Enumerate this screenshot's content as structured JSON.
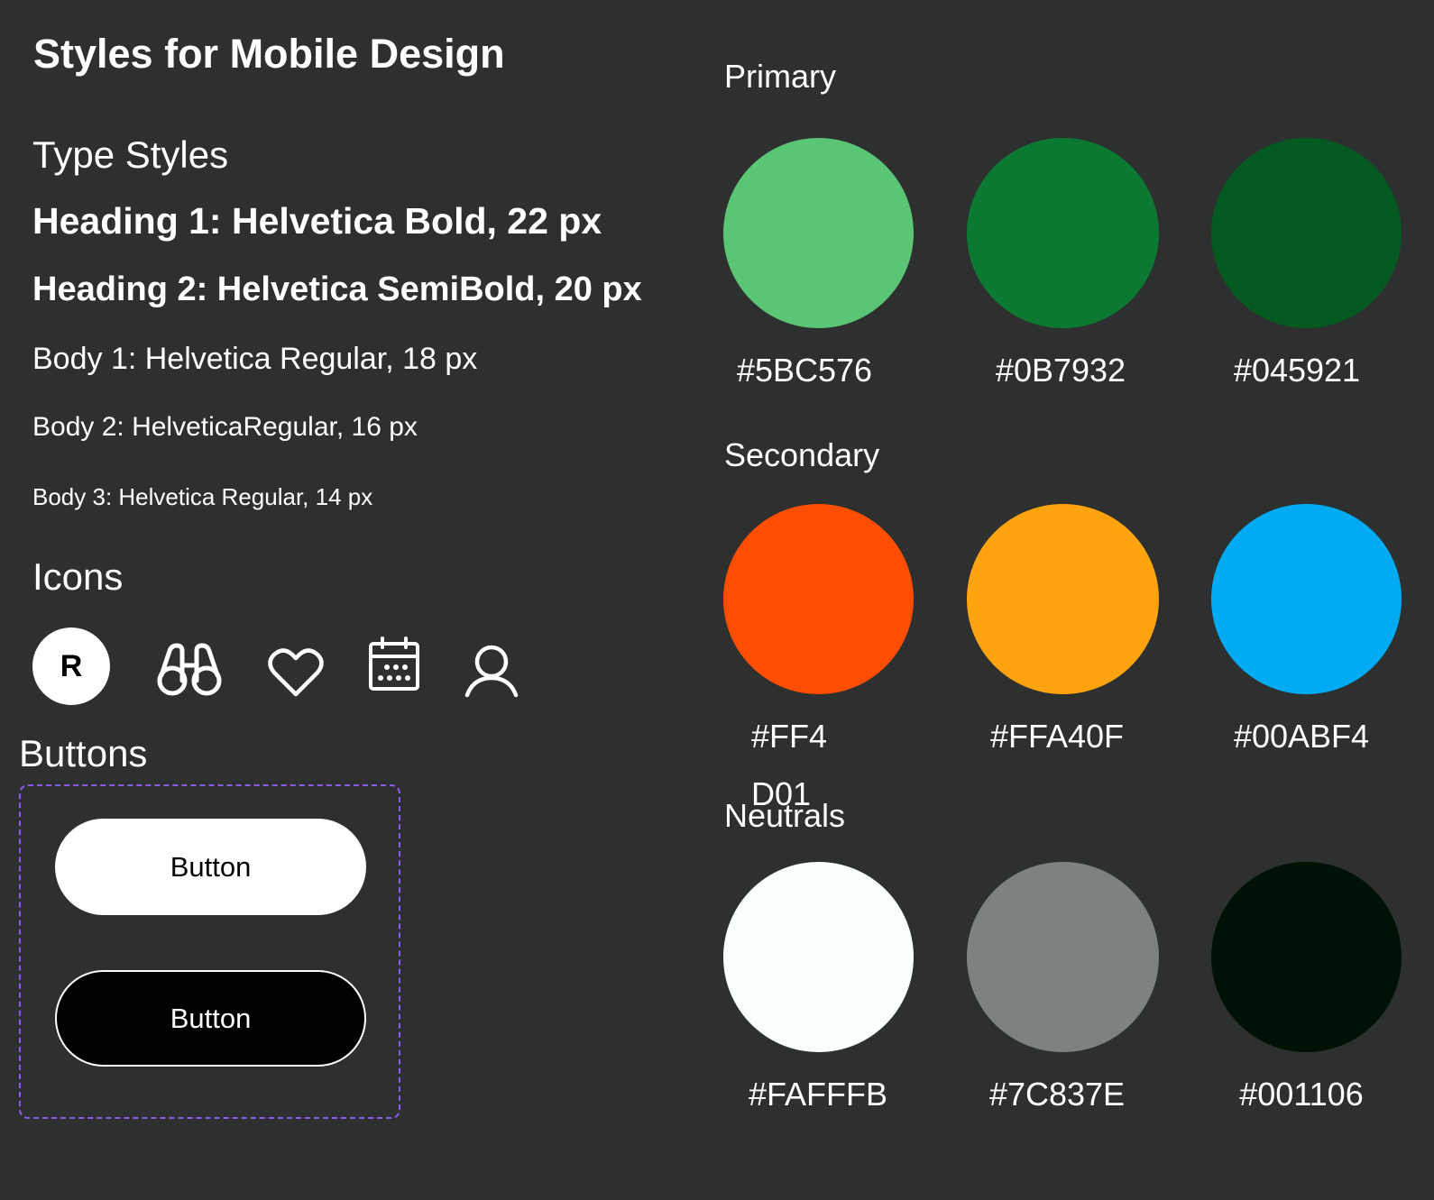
{
  "title": "Styles for Mobile Design",
  "type_styles": {
    "heading": "Type Styles",
    "h1": "Heading 1: Helvetica Bold, 22 px",
    "h2": "Heading 2: Helvetica SemiBold, 20 px",
    "body1": "Body 1: Helvetica Regular, 18 px",
    "body2": "Body 2: HelveticaRegular, 16 px",
    "body3": "Body 3: Helvetica Regular, 14 px"
  },
  "icons": {
    "heading": "Icons",
    "avatar_letter": "R",
    "list": [
      "avatar-icon",
      "binoculars-icon",
      "heart-icon",
      "calendar-icon",
      "user-icon"
    ]
  },
  "buttons": {
    "heading": "Buttons",
    "light_label": "Button",
    "dark_label": "Button"
  },
  "palette": {
    "primary": {
      "label": "Primary",
      "swatches": [
        {
          "color": "#5BC576",
          "label": "#5BC576"
        },
        {
          "color": "#0B7932",
          "label": "#0B7932"
        },
        {
          "color": "#045921",
          "label": "#045921"
        }
      ]
    },
    "secondary": {
      "label": "Secondary",
      "swatches": [
        {
          "color": "#FF4D01",
          "label": "#FF4",
          "label_overflow": "D01"
        },
        {
          "color": "#FFA40F",
          "label": "#FFA40F"
        },
        {
          "color": "#00ABF4",
          "label": "#00ABF4"
        }
      ]
    },
    "neutrals": {
      "label": "Neutrals",
      "swatches": [
        {
          "color": "#FAFFFB",
          "label": "#FAFFFB"
        },
        {
          "color": "#7C837E",
          "label": "#7C837E"
        },
        {
          "color": "#001106",
          "label": "#001106"
        }
      ]
    }
  }
}
